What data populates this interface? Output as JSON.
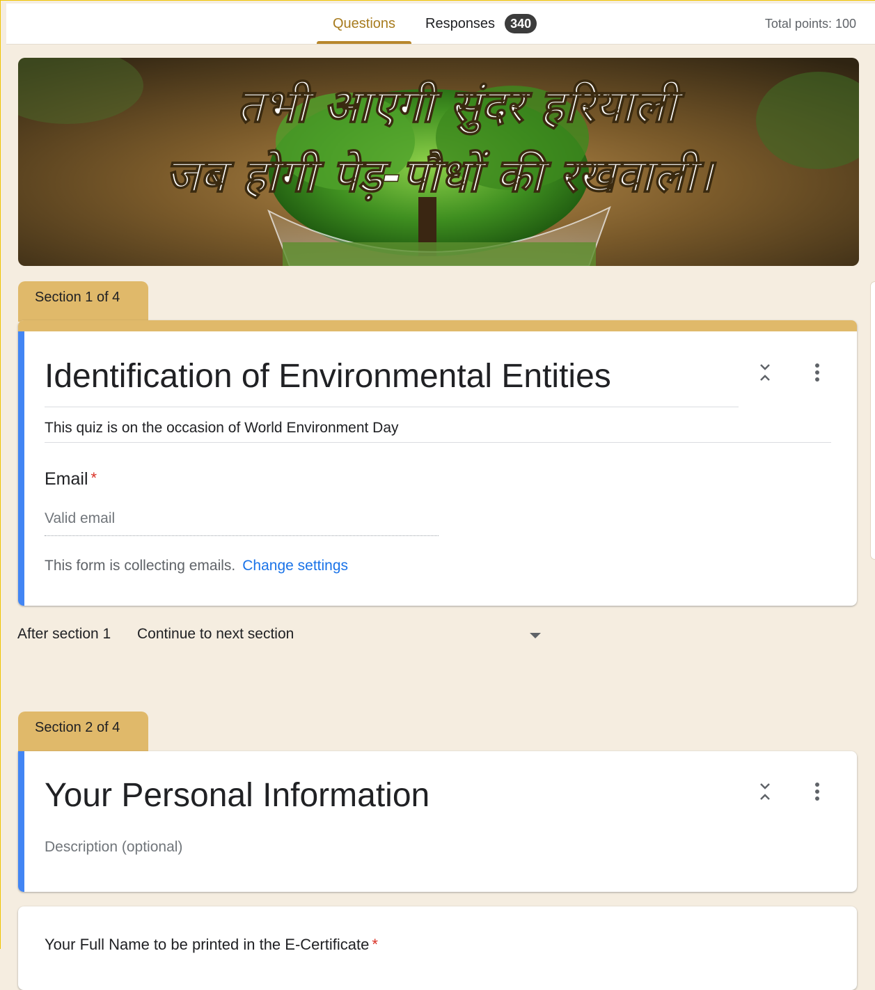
{
  "tabs": {
    "questions": "Questions",
    "responses": "Responses",
    "responses_count": "340",
    "total_points": "Total points: 100"
  },
  "banner": {
    "line1": "तभी आएगी सुंदर हरियाली",
    "line2": "जब होगी पेड़-पौधों की रखवाली।"
  },
  "section1": {
    "tag": "Section 1 of 4",
    "title": "Identification of Environmental Entities",
    "description": "This quiz is on the occasion of World Environment Day",
    "email_label": "Email",
    "required_mark": "*",
    "email_placeholder": "Valid email",
    "collect_note": "This form is collecting emails.",
    "change_settings": "Change settings"
  },
  "after_section": {
    "label": "After section 1",
    "value": "Continue to next section"
  },
  "section2": {
    "tag": "Section 2 of 4",
    "title": "Your Personal Information",
    "description_placeholder": "Description (optional)",
    "question1": "Your Full Name to be printed in the E-Certificate",
    "required_mark": "*"
  },
  "colors": {
    "accent_gold": "#e0b96a",
    "accent_blue": "#4285f4",
    "page_bg": "#f5ede0",
    "link_blue": "#1a73e8"
  }
}
